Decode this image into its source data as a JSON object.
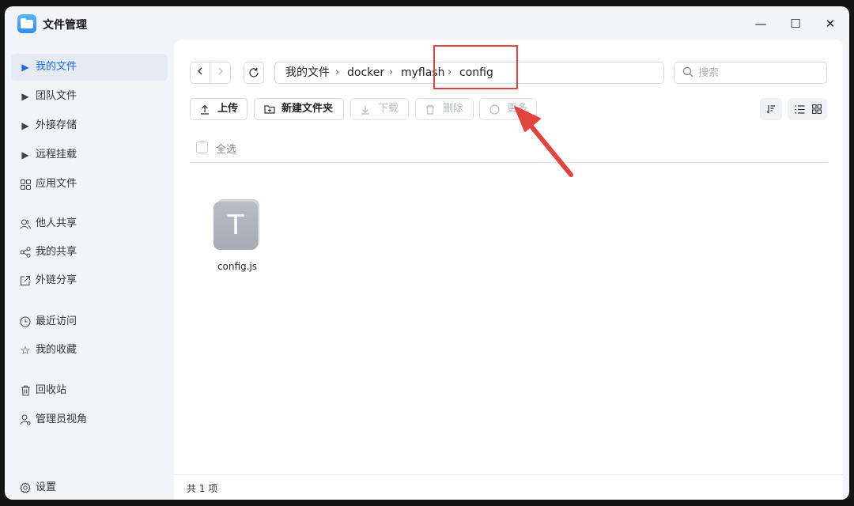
{
  "app": {
    "title": "文件管理",
    "icon": "folder-app-icon"
  },
  "window_controls": {
    "minimize": "—",
    "maximize": "☐",
    "close": "✕"
  },
  "sidebar": {
    "items": [
      {
        "label": "我的文件",
        "icon": "caret-right-icon",
        "active": true
      },
      {
        "label": "团队文件",
        "icon": "caret-right-icon"
      },
      {
        "label": "外接存储",
        "icon": "caret-right-icon"
      },
      {
        "label": "远程挂载",
        "icon": "caret-right-icon"
      },
      {
        "label": "应用文件",
        "icon": "apps-grid-icon"
      },
      {
        "label": "他人共享",
        "icon": "users-icon"
      },
      {
        "label": "我的共享",
        "icon": "share-icon"
      },
      {
        "label": "外链分享",
        "icon": "external-link-icon"
      },
      {
        "label": "最近访问",
        "icon": "clock-icon"
      },
      {
        "label": "我的收藏",
        "icon": "star-icon"
      },
      {
        "label": "回收站",
        "icon": "trash-icon"
      },
      {
        "label": "管理员视角",
        "icon": "admin-icon"
      }
    ],
    "settings_label": "设置"
  },
  "path": {
    "crumbs": [
      "我的文件",
      "docker",
      "myflash",
      "config"
    ]
  },
  "search": {
    "placeholder": "搜索"
  },
  "toolbar": {
    "upload": "上传",
    "new_folder": "新建文件夹",
    "download": "下载",
    "delete": "删除",
    "more": "更多"
  },
  "select_all": "全选",
  "files": [
    {
      "name": "config.js",
      "type_letter": "T"
    }
  ],
  "status": {
    "count_text": "共 1 项"
  },
  "colors": {
    "accent": "#1e6be6",
    "annotation": "#e2433d"
  }
}
